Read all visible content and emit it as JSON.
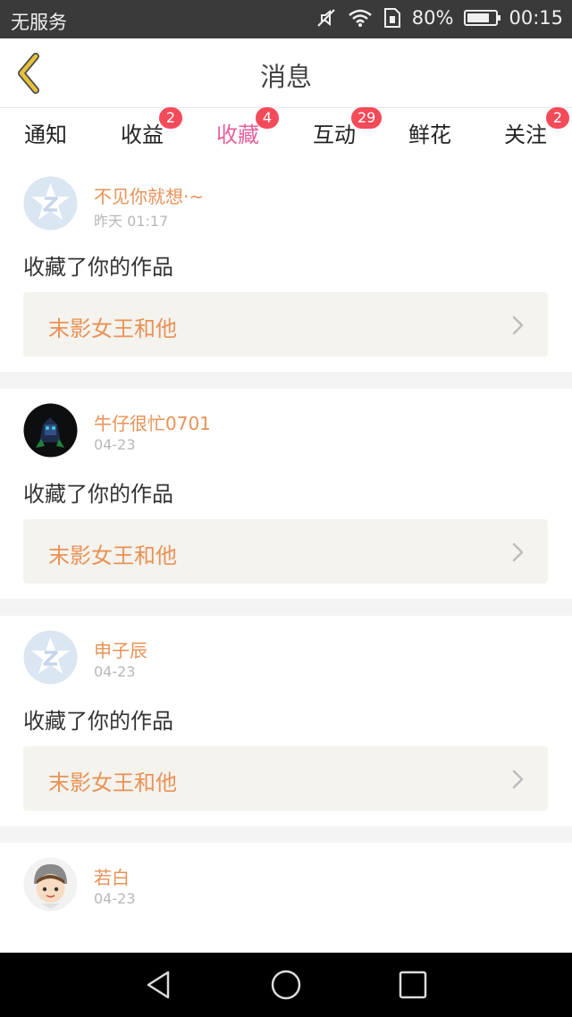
{
  "status": {
    "carrier": "无服务",
    "battery": "80%",
    "battery_level": 0.8,
    "time": "00:15"
  },
  "header": {
    "title": "消息"
  },
  "tabs": [
    {
      "label": "通知",
      "badge": ""
    },
    {
      "label": "收益",
      "badge": "2"
    },
    {
      "label": "收藏",
      "badge": "4",
      "active": true
    },
    {
      "label": "互动",
      "badge": "29"
    },
    {
      "label": "鲜花",
      "badge": ""
    },
    {
      "label": "关注",
      "badge": "2"
    }
  ],
  "messages": [
    {
      "username": "不见你就想·~",
      "time": "昨天 01:17",
      "action": "收藏了你的作品",
      "work": "末影女王和他",
      "avatar": "qq-default"
    },
    {
      "username": "牛仔很忙0701",
      "time": "04-23",
      "action": "收藏了你的作品",
      "work": "末影女王和他",
      "avatar": "dark-photo"
    },
    {
      "username": "申子辰",
      "time": "04-23",
      "action": "收藏了你的作品",
      "work": "末影女王和他",
      "avatar": "qq-default"
    },
    {
      "username": "若白",
      "time": "04-23",
      "action": "",
      "work": "",
      "avatar": "cartoon-boy"
    }
  ],
  "colors": {
    "accent": "#e6609c",
    "username": "#e99256",
    "badge": "#f44b5a",
    "back_arrow": "#e6c13a"
  }
}
